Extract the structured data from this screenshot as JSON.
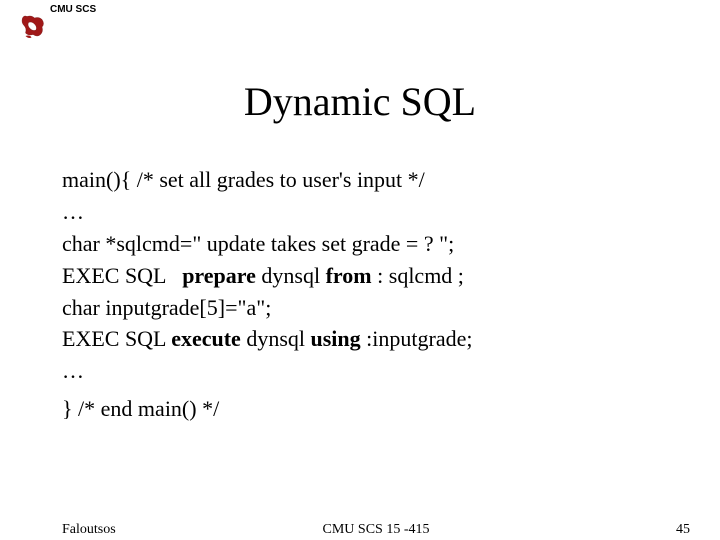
{
  "header": {
    "label": "CMU SCS"
  },
  "title": "Dynamic SQL",
  "code": {
    "l1": "main(){ /* set all grades to user's input */",
    "l2": "…",
    "l3": "char *sqlcmd=\" update takes set grade = ? \";",
    "l4a": "EXEC SQL   ",
    "l4b": "prepare ",
    "l4c": "dynsql ",
    "l4d": "from ",
    "l4e": ": sqlcmd ;",
    "l5": "char inputgrade[5]=\"a\";",
    "l6a": "EXEC SQL ",
    "l6b": "execute ",
    "l6c": "dynsql ",
    "l6d": "using ",
    "l6e": ":inputgrade;",
    "l7": "…",
    "l8": "} /* end main() */"
  },
  "footer": {
    "left": "Faloutsos",
    "center": "CMU SCS 15 -415",
    "right": "45"
  }
}
